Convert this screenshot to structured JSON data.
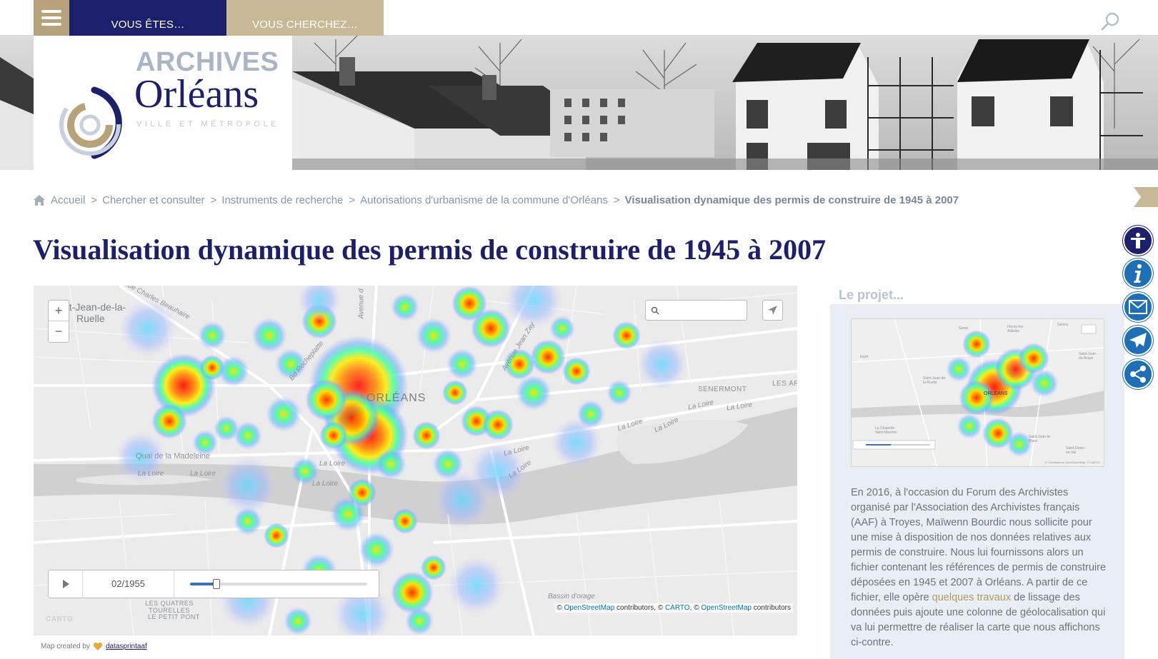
{
  "nav": {
    "tab1_label": "VOUS ÊTES…",
    "tab2_label": "VOUS CHERCHEZ…",
    "menu_icon": "hamburger-icon",
    "search_icon": "search-icon"
  },
  "logo": {
    "line1": "ARCHIVES",
    "line2": "Orléans",
    "line3": "VILLE ET MÉTROPOLE"
  },
  "breadcrumb": {
    "home": "Accueil",
    "items": [
      "Chercher et consulter",
      "Instruments de recherche",
      "Autorisations d'urbanisme de la commune d'Orléans"
    ],
    "current": "Visualisation dynamique des permis de construire de 1945 à 2007",
    "separator": ">"
  },
  "title": "Visualisation dynamique des permis de construire de 1945 à 2007",
  "map": {
    "zoom_in": "+",
    "zoom_out": "−",
    "search_placeholder": "",
    "timeline_date": "02/1955",
    "timeline_progress": 0.15,
    "labels": {
      "saint_jean": "nt-Jean-de-la-",
      "ruelle": "Ruelle",
      "orleans": "ORLÉANS",
      "senermont": "SENERMONT",
      "les_ar": "LES AR",
      "quai": "Quai de la Madeleine",
      "loire1": "La Loire",
      "loire2": "La Loire",
      "loire3": "La Loire",
      "loire4": "La Loire",
      "loire5": "La Loire",
      "loire6": "La Loire",
      "loire7": "La Loire",
      "loire8": "La Loire",
      "loire9": "La Loire",
      "loire10": "La Loire",
      "rue_beauhaire": "Rue Charles Beauhaire",
      "bd_rocheplatte": "Bd Rocheplatte",
      "avenue_jean_zay": "Avenue Jean Zay",
      "avenue_d": "Avenue d",
      "bassin": "Bassin d'orage",
      "quatres_tourelles": "LES QUATRES TOURELLES",
      "petit_pont": "LE PETIT PONT",
      "carto": "CARTO"
    },
    "attribution": {
      "prefix": "©",
      "osm1": "OpenStreetMap",
      "mid1": "contributors, ©",
      "carto": "CARTO",
      "mid2": ", ©",
      "osm2": "OpenStreetMap",
      "suffix": "contributors"
    }
  },
  "credit": {
    "prefix": "Map created by",
    "author": "datasprintaaf"
  },
  "sidebar": {
    "title": "Le projet...",
    "thumb_labels": {
      "orleans": "ORLÉANS",
      "fleury": "Fleury-les-Aubrais",
      "saint_jean_ruelle": "Saint-Jean-de-la-Ruelle",
      "chapelle": "La Chapelle-Saint-Mesmin",
      "saint_jean_braye": "Saint-Jean-de-Braye",
      "saint_jean_blanc": "Saint-Jean-le-Blanc",
      "saint_denis": "Saint-Denis-en-Val",
      "ingre": "Ingré",
      "semoy": "Semoy",
      "saran": "Saran",
      "credit": "© Contributeurs OpenStreetMap, © CARTO"
    },
    "text_before": "En 2016, à l'occasion du Forum des Archivistes organisé par l'Association des Archivistes français (AAF) à Troyes, Maïwenn Bourdic nous sollicite pour une mise à disposition de nos données relatives aux permis de construire. Nous lui fournissons alors un fichier contenant les références de permis de construire déposées en 1945 et 2007 à Orléans. A partir de ce fichier, elle opère",
    "link": "quelques travaux",
    "text_after": "de lissage des données puis ajoute une colonne de géolocalisation qui va lui permettre de réaliser la carte que nous affichons ci-contre."
  },
  "float_buttons": [
    "accessibility-icon",
    "info-icon",
    "mail-icon",
    "send-icon",
    "share-icon"
  ],
  "colors": {
    "navy": "#1c1f6b",
    "gold": "#b8a27a",
    "sand": "#c9b896",
    "blue": "#1e6fb5",
    "panel": "#e8eef4"
  }
}
